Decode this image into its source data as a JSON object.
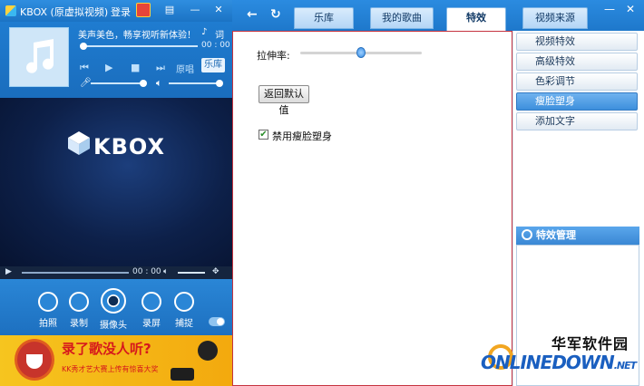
{
  "left": {
    "app_title": "KBOX (原虚拟视频)",
    "login_label": "登录",
    "window_buttons": [
      "▤",
      "—",
      "✕"
    ],
    "song_text": "美声美色，畅享视听新体验！",
    "song_ctl1": "♪",
    "song_ctl2": "词",
    "time": "00 : 00",
    "karaoke_label": "原唱",
    "library_button": "乐库",
    "video_logo": "KBOX",
    "video_time": "00 : 00",
    "tools": [
      {
        "label": "拍照"
      },
      {
        "label": "录制"
      },
      {
        "label": "摄像头"
      },
      {
        "label": "录屏"
      },
      {
        "label": "捕捉"
      }
    ],
    "ad_title": "录了歌没人听?",
    "ad_sub": "KK秀才艺大赛上传有惊喜大奖"
  },
  "top": {
    "tabs": [
      "乐库",
      "我的歌曲",
      "特效",
      "视频来源"
    ],
    "active_tab": "特效",
    "right_btns": [
      "—",
      "✕"
    ]
  },
  "panel": {
    "stretch_label": "拉伸率:",
    "stretch_value_pct": 47,
    "reset_button": "返回默认值",
    "checkbox_label": "禁用瘦脸塑身",
    "checkbox_checked": true
  },
  "side": {
    "buttons": [
      "视频特效",
      "高级特效",
      "色彩调节",
      "瘦脸塑身",
      "添加文字"
    ],
    "active": "瘦脸塑身",
    "manager_title": "特效管理"
  },
  "watermark": {
    "cn": "华军软件园",
    "en": "ONLINEDOWN",
    "net": ".NET"
  }
}
